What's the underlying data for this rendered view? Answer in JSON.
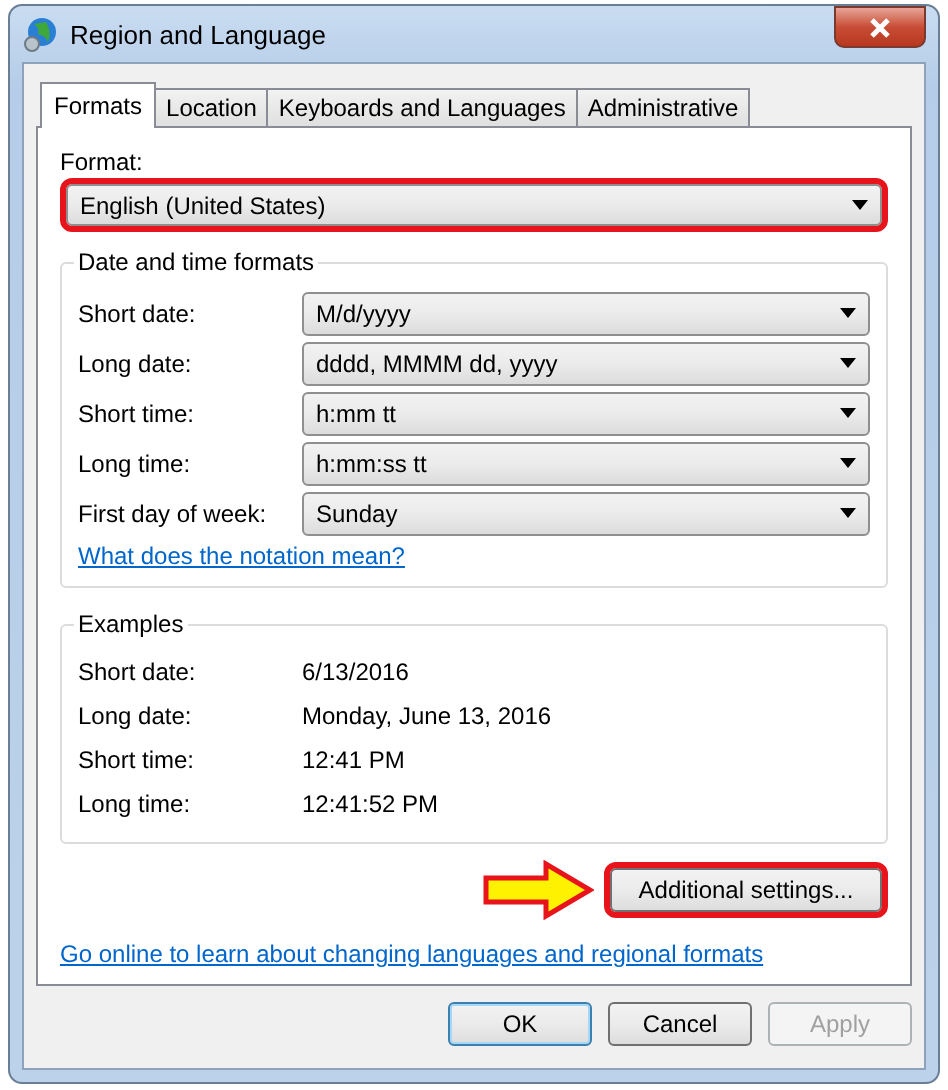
{
  "window": {
    "title": "Region and Language"
  },
  "tabs": [
    {
      "label": "Formats",
      "selected": true
    },
    {
      "label": "Location",
      "selected": false
    },
    {
      "label": "Keyboards and Languages",
      "selected": false
    },
    {
      "label": "Administrative",
      "selected": false
    }
  ],
  "format": {
    "label": "Format:",
    "value": "English (United States)",
    "highlighted": true
  },
  "date_time_formats": {
    "title": "Date and time formats",
    "rows": [
      {
        "label": "Short date:",
        "value": "M/d/yyyy"
      },
      {
        "label": "Long date:",
        "value": "dddd, MMMM dd, yyyy"
      },
      {
        "label": "Short time:",
        "value": "h:mm tt"
      },
      {
        "label": "Long time:",
        "value": "h:mm:ss tt"
      },
      {
        "label": "First day of week:",
        "value": "Sunday"
      }
    ],
    "link": "What does the notation mean?"
  },
  "examples": {
    "title": "Examples",
    "rows": [
      {
        "label": "Short date:",
        "value": "6/13/2016"
      },
      {
        "label": "Long date:",
        "value": "Monday, June 13, 2016"
      },
      {
        "label": "Short time:",
        "value": "12:41 PM"
      },
      {
        "label": "Long time:",
        "value": "12:41:52 PM"
      }
    ]
  },
  "additional_settings": {
    "label": "Additional settings...",
    "highlighted": true
  },
  "online_link": "Go online to learn about changing languages and regional formats",
  "buttons": [
    {
      "label": "OK",
      "kind": "default",
      "disabled": false
    },
    {
      "label": "Cancel",
      "kind": "normal",
      "disabled": false
    },
    {
      "label": "Apply",
      "kind": "normal",
      "disabled": true
    }
  ]
}
